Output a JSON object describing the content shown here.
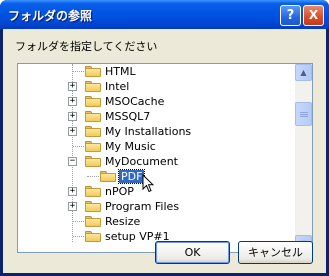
{
  "window": {
    "title": "フォルダの参照",
    "help_glyph": "?",
    "close_glyph": "X"
  },
  "prompt": "フォルダを指定してください",
  "tree": {
    "items": [
      {
        "label": "HTML",
        "expander": null,
        "selected": false
      },
      {
        "label": "Intel",
        "expander": "+",
        "selected": false
      },
      {
        "label": "MSOCache",
        "expander": "+",
        "selected": false
      },
      {
        "label": "MSSQL7",
        "expander": "+",
        "selected": false
      },
      {
        "label": "My Installations",
        "expander": "+",
        "selected": false
      },
      {
        "label": "My Music",
        "expander": null,
        "selected": false
      },
      {
        "label": "MyDocument",
        "expander": "−",
        "selected": false
      },
      {
        "label": "PDF",
        "expander": null,
        "selected": true
      },
      {
        "label": "nPOP",
        "expander": "+",
        "selected": false
      },
      {
        "label": "Program Files",
        "expander": "+",
        "selected": false
      },
      {
        "label": "Resize",
        "expander": null,
        "selected": false
      },
      {
        "label": "setup VP#1",
        "expander": null,
        "selected": false
      }
    ]
  },
  "scrollbar": {
    "up_glyph": "▲",
    "down_glyph": "▼"
  },
  "buttons": {
    "ok": "OK",
    "cancel": "キャンセル"
  }
}
